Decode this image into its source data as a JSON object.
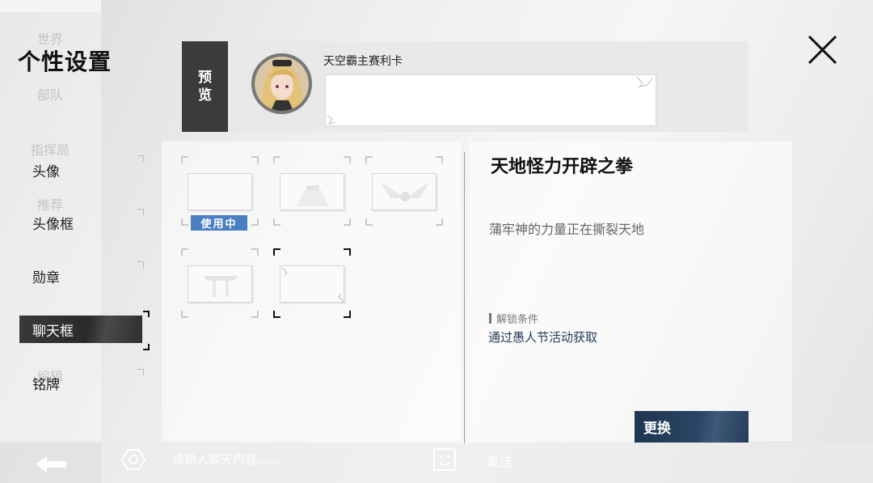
{
  "background_menu": [
    "世界",
    "部队",
    "指挥局",
    "推荐",
    "编辑"
  ],
  "page_title": "个性设置",
  "nav": {
    "items": [
      {
        "label": "头像",
        "active": false
      },
      {
        "label": "头像框",
        "active": false
      },
      {
        "label": "勋章",
        "active": false
      },
      {
        "label": "聊天框",
        "active": true
      },
      {
        "label": "铭牌",
        "active": false
      }
    ]
  },
  "preview": {
    "label": "预览",
    "player_name": "天空霸主赛利卡"
  },
  "frames": {
    "in_use_label": "使用中"
  },
  "detail": {
    "title": "天地怪力开辟之拳",
    "description": "蒲牢神的力量正在撕裂天地",
    "unlock_label": "解锁条件",
    "unlock_value": "通过愚人节活动获取"
  },
  "change_button": "更换",
  "chat": {
    "placeholder": "请输入聊天内容......",
    "send_label": "发送"
  },
  "colors": {
    "accent_blue": "#4a7fc1",
    "button_dark_blue": "#1f3550",
    "active_nav": "#2f2f2f"
  },
  "icons": [
    "close-icon",
    "settings-hex-icon",
    "emoji-icon",
    "back-arrow-icon"
  ]
}
